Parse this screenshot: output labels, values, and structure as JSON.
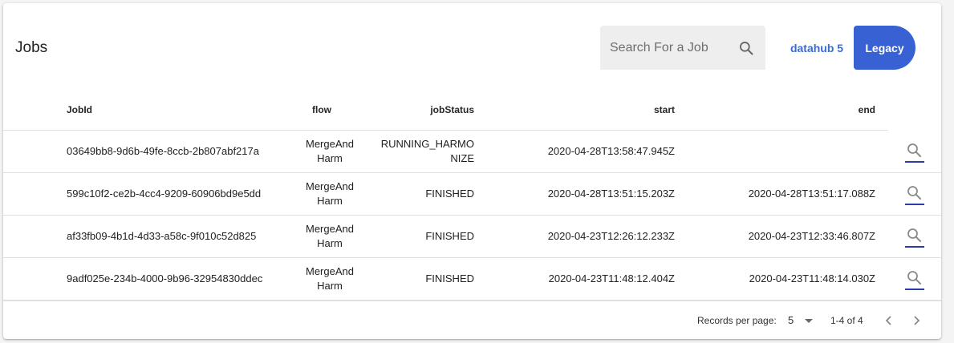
{
  "header": {
    "title": "Jobs",
    "search_placeholder": "Search For a Job",
    "link_label": "datahub 5",
    "legacy_label": "Legacy"
  },
  "table": {
    "columns": [
      "JobId",
      "flow",
      "jobStatus",
      "start",
      "end"
    ],
    "rows": [
      {
        "jobid": "03649bb8-9d6b-49fe-8ccb-2b807abf217a",
        "flow": "MergeAndHarm",
        "status": "RUNNING_HARMONIZE",
        "start": "2020-04-28T13:58:47.945Z",
        "end": ""
      },
      {
        "jobid": "599c10f2-ce2b-4cc4-9209-60906bd9e5dd",
        "flow": "MergeAndHarm",
        "status": "FINISHED",
        "start": "2020-04-28T13:51:15.203Z",
        "end": "2020-04-28T13:51:17.088Z"
      },
      {
        "jobid": "af33fb09-4b1d-4d33-a58c-9f010c52d825",
        "flow": "MergeAndHarm",
        "status": "FINISHED",
        "start": "2020-04-23T12:26:12.233Z",
        "end": "2020-04-23T12:33:46.807Z"
      },
      {
        "jobid": "9adf025e-234b-4000-9b96-32954830ddec",
        "flow": "MergeAndHarm",
        "status": "FINISHED",
        "start": "2020-04-23T11:48:12.404Z",
        "end": "2020-04-23T11:48:14.030Z"
      }
    ],
    "row_action_icon": "search-icon"
  },
  "footer": {
    "rows_per_page_label": "Records per page:",
    "rows_per_page_value": "5",
    "range_label": "1-4 of 4"
  },
  "colors": {
    "accent": "#3862d4",
    "link": "#3b6cd6",
    "underline": "#2d3ca8"
  }
}
